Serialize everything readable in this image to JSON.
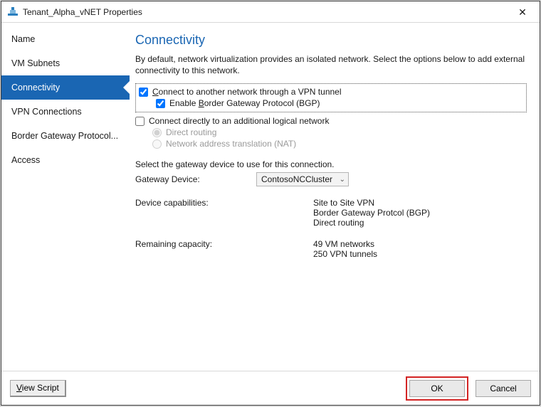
{
  "window": {
    "title": "Tenant_Alpha_vNET Properties"
  },
  "sidebar": {
    "items": [
      {
        "label": "Name"
      },
      {
        "label": "VM Subnets"
      },
      {
        "label": "Connectivity"
      },
      {
        "label": "VPN Connections"
      },
      {
        "label": "Border Gateway Protocol..."
      },
      {
        "label": "Access"
      }
    ],
    "selected_index": 2
  },
  "page": {
    "title": "Connectivity",
    "description": "By default, network virtualization provides an isolated network. Select the options below to add external connectivity to this network.",
    "vpn_checkbox_label_full": "Connect to another network through a VPN tunnel",
    "vpn_checkbox_accel": "C",
    "vpn_checkbox_rest": "onnect to another network through a VPN tunnel",
    "vpn_checked": true,
    "bgp_label_full": "Enable Border Gateway Protocol (BGP)",
    "bgp_accel": "B",
    "bgp_prefix": "Enable ",
    "bgp_rest": "order Gateway Protocol (BGP)",
    "bgp_checked": true,
    "direct_checkbox_label": "Connect directly to an additional logical network",
    "direct_checked": false,
    "radio_direct_full": "Direct routing",
    "radio_direct_accel": "D",
    "radio_direct_rest": "irect routing",
    "radio_nat_full": "Network address translation (NAT)",
    "radio_nat_accel": "N",
    "radio_nat_rest": "etwork address translation (NAT)",
    "gateway_instruction": "Select the gateway device to use for this connection.",
    "gateway_label_full": "Gateway Device:",
    "gateway_label_accel": "G",
    "gateway_label_rest": "ateway Device:",
    "gateway_value": "ContosoNCCluster",
    "capabilities_label": "Device capabilities:",
    "capabilities_values": "Site to Site VPN\nBorder Gateway Protcol (BGP)\nDirect routing",
    "remaining_label": "Remaining capacity:",
    "remaining_values": "49 VM networks\n250 VPN tunnels"
  },
  "footer": {
    "view_script_label": "View Script",
    "view_script_accel": "V",
    "view_script_rest": "iew Script",
    "ok": "OK",
    "cancel": "Cancel"
  }
}
